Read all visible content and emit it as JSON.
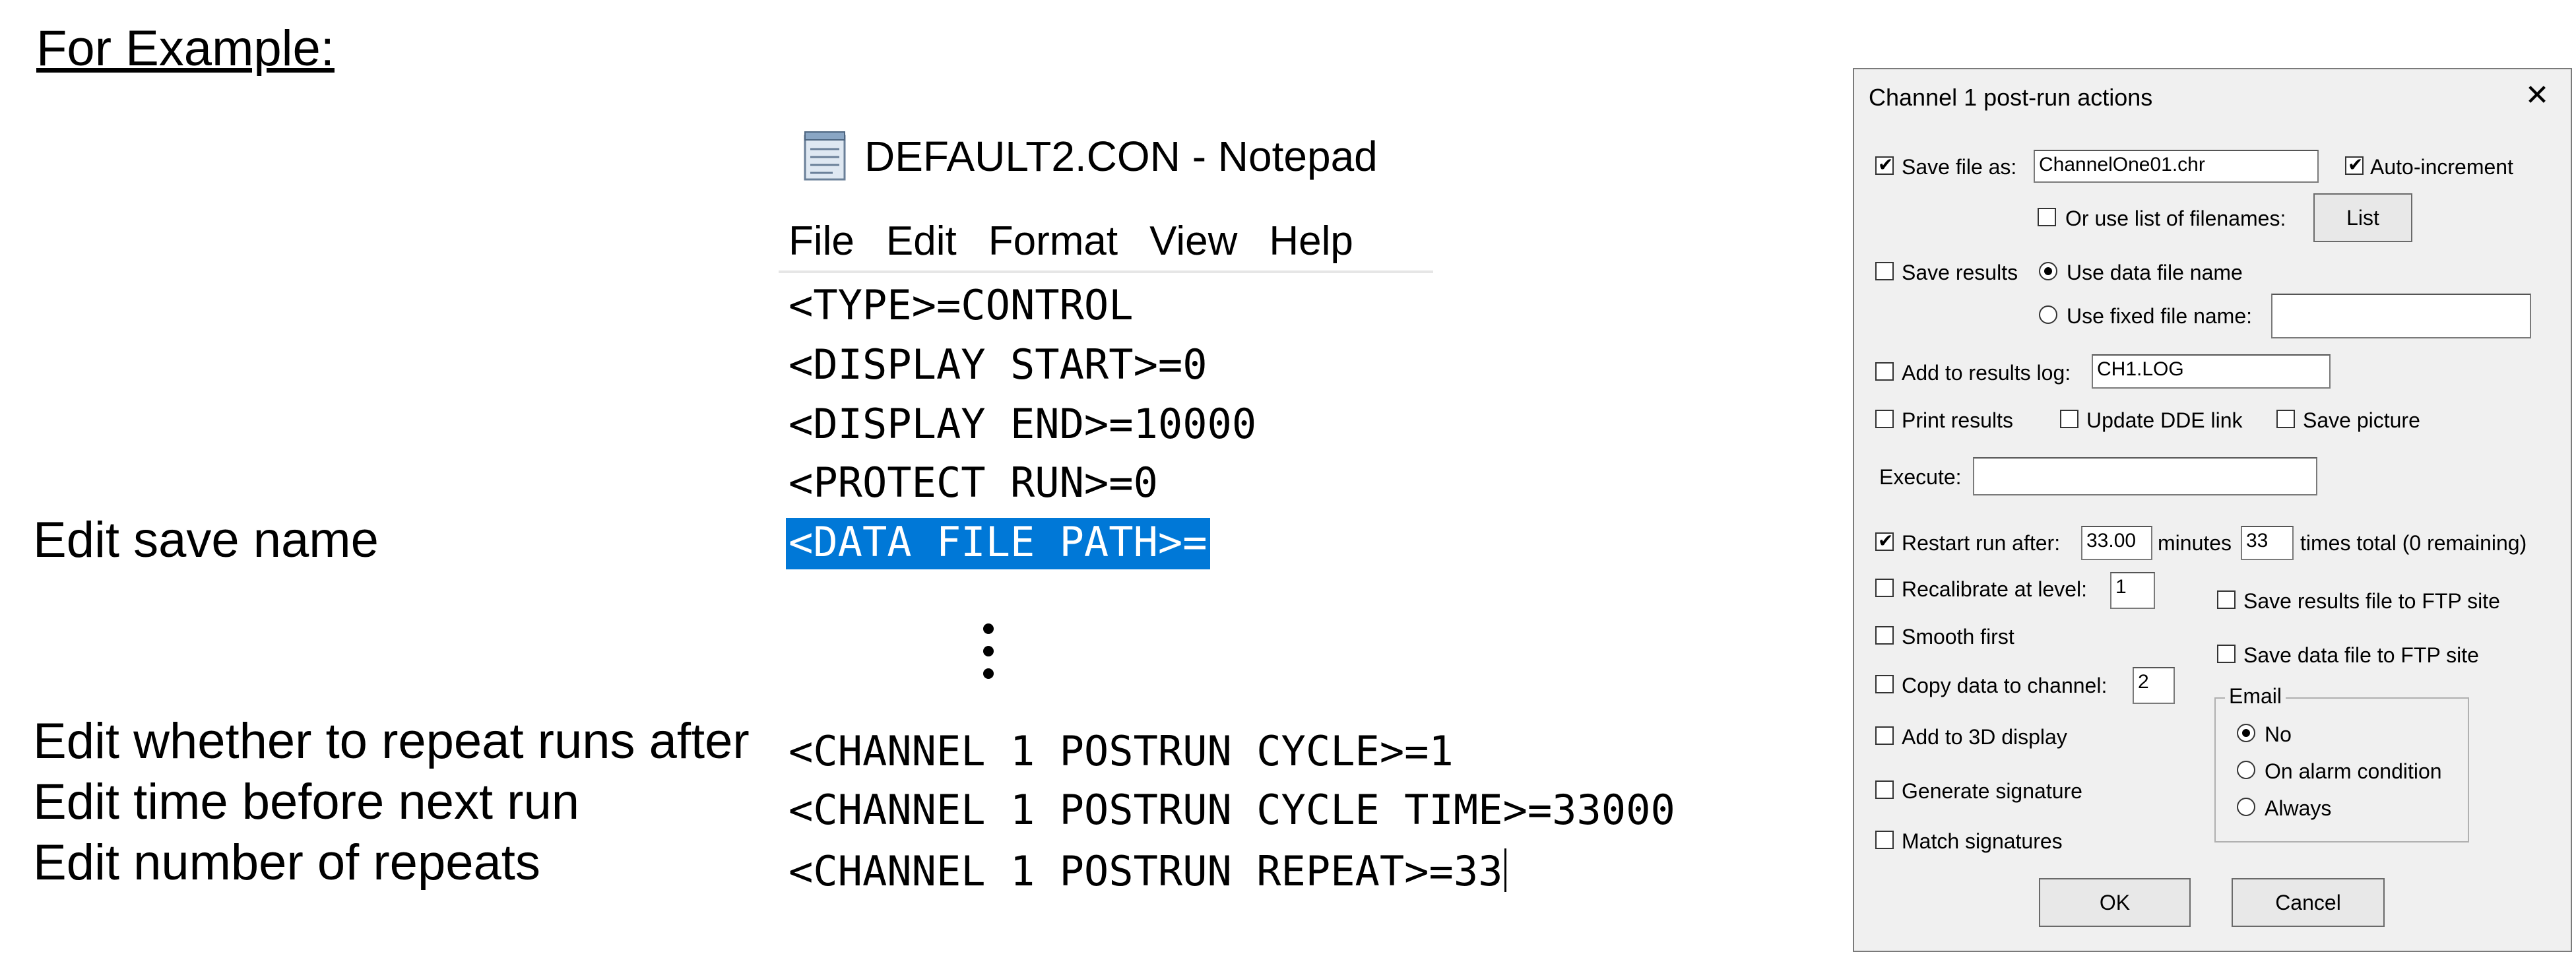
{
  "left": {
    "heading": "For Example:",
    "edit_save_name": "Edit save name",
    "edit_repeat": "Edit whether to repeat runs after",
    "edit_time": "Edit time before next run",
    "edit_number": "Edit number of repeats"
  },
  "notepad": {
    "title": "DEFAULT2.CON - Notepad",
    "menu": [
      "File",
      "Edit",
      "Format",
      "View",
      "Help"
    ],
    "lines": [
      "<TYPE>=CONTROL",
      "<DISPLAY START>=0",
      "<DISPLAY END>=10000",
      "<PROTECT RUN>=0",
      "<DATA FILE PATH>="
    ],
    "lines_bottom": [
      "<CHANNEL 1 POSTRUN CYCLE>=1",
      "<CHANNEL 1 POSTRUN CYCLE TIME>=33000",
      "<CHANNEL 1 POSTRUN REPEAT>=33"
    ],
    "selected_line_index": 4
  },
  "dialog": {
    "title": "Channel 1 post-run actions",
    "save_file_as": {
      "label": "Save file as:",
      "checked": true,
      "value": "ChannelOne01.chr"
    },
    "auto_increment": {
      "label": "Auto-increment",
      "checked": true
    },
    "use_list": {
      "label": "Or use list of filenames:",
      "checked": false
    },
    "list_button": "List",
    "save_results": {
      "label": "Save results",
      "checked": false
    },
    "use_data_file_name": {
      "label": "Use data file name",
      "selected": true
    },
    "use_fixed_file_name": {
      "label": "Use fixed file name:",
      "selected": false,
      "value": ""
    },
    "add_to_results_log": {
      "label": "Add to results log:",
      "checked": false,
      "value": "CH1.LOG"
    },
    "print_results": {
      "label": "Print results",
      "checked": false
    },
    "update_dde_link": {
      "label": "Update DDE link",
      "checked": false
    },
    "save_picture": {
      "label": "Save picture",
      "checked": false
    },
    "execute": {
      "label": "Execute:",
      "value": ""
    },
    "restart_run": {
      "label": "Restart run after:",
      "checked": true,
      "value": "33.00",
      "minutes_label": "minutes",
      "times_value": "33",
      "times_label": "times total  (0 remaining)"
    },
    "recalibrate": {
      "label": "Recalibrate at level:",
      "checked": false,
      "value": "1"
    },
    "save_results_ftp": {
      "label": "Save results file to FTP site",
      "checked": false
    },
    "smooth_first": {
      "label": "Smooth first",
      "checked": false
    },
    "save_data_ftp": {
      "label": "Save data file to FTP site",
      "checked": false
    },
    "copy_data": {
      "label": "Copy data to channel:",
      "checked": false,
      "value": "2"
    },
    "email": {
      "label": "Email",
      "options": [
        "No",
        "On alarm condition",
        "Always"
      ],
      "selected": 0
    },
    "add_3d": {
      "label": "Add to 3D display",
      "checked": false
    },
    "generate_signature": {
      "label": "Generate signature",
      "checked": false
    },
    "match_signatures": {
      "label": "Match signatures",
      "checked": false
    },
    "ok": "OK",
    "cancel": "Cancel"
  }
}
